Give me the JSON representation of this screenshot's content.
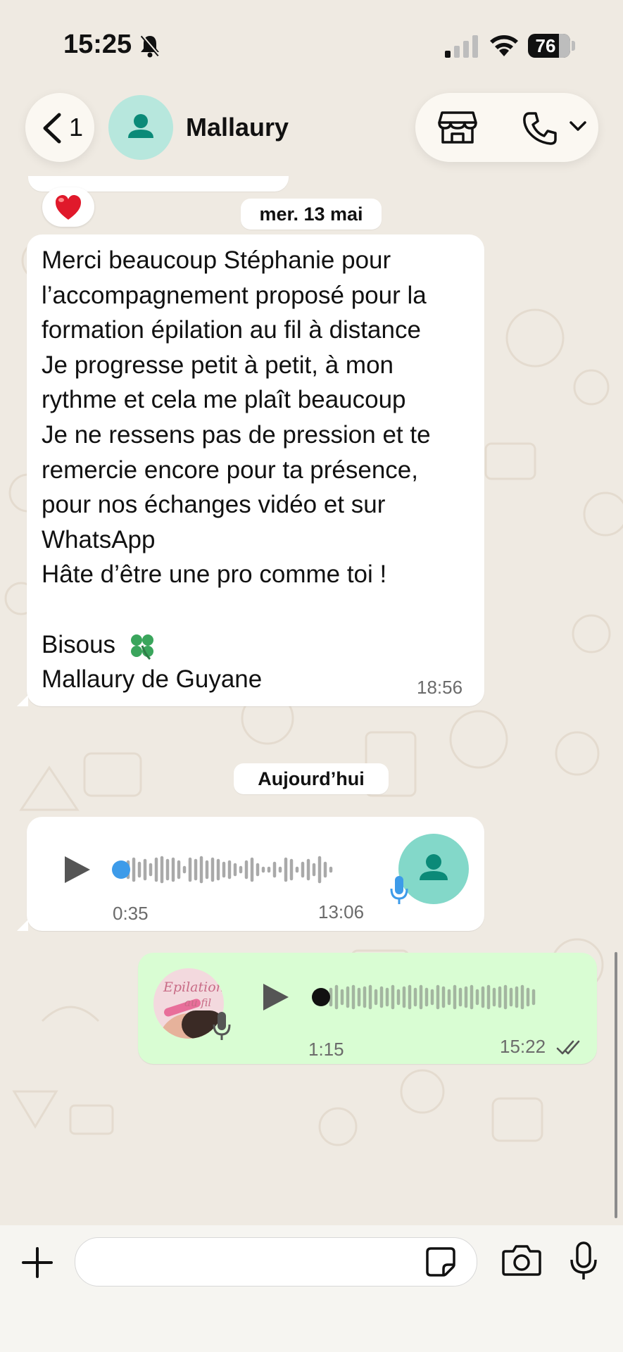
{
  "status_bar": {
    "time": "15:25",
    "battery": "76",
    "icons": [
      "bell-slash-icon",
      "signal-icon",
      "wifi-icon",
      "battery-icon"
    ]
  },
  "header": {
    "back_count": "1",
    "contact_name": "Mallaury",
    "icons": [
      "chevron-left-icon",
      "avatar-icon",
      "store-icon",
      "phone-icon",
      "chevron-down-icon"
    ]
  },
  "chat": {
    "date_chip": "mer. 13 mai",
    "reaction": "❤️",
    "message1": {
      "text": "Merci beaucoup Stéphanie pour\nl’accompagnement proposé pour la\nformation épilation au fil à distance\nJe progresse petit à petit, à mon\nrythme et cela me plaît beaucoup\nJe ne ressens pas de pression et te\nremercie encore pour ta présence,\npour nos échanges vidéo et sur\nWhatsApp\nHâte d’être une pro comme toi !\n\nBisous",
      "signature": "Mallaury de Guyane",
      "emoji": "🍀",
      "time": "18:56"
    },
    "today_chip": "Aujourd’hui",
    "voice_in": {
      "duration": "0:35",
      "time": "13:06",
      "progress": 0.02
    },
    "voice_out": {
      "duration": "1:15",
      "time": "15:22",
      "logo_text_1": "Epilation",
      "logo_text_2": "au fil",
      "progress": 0.0,
      "read": true
    }
  },
  "composer": {
    "placeholder": "",
    "icons": [
      "plus-icon",
      "sticker-icon",
      "camera-icon",
      "microphone-icon"
    ]
  },
  "colors": {
    "background": "#efeae2",
    "bubble_in": "#ffffff",
    "bubble_out": "#d9fdd3",
    "avatar": "#83d8c9",
    "accent": "#0b8a78"
  }
}
